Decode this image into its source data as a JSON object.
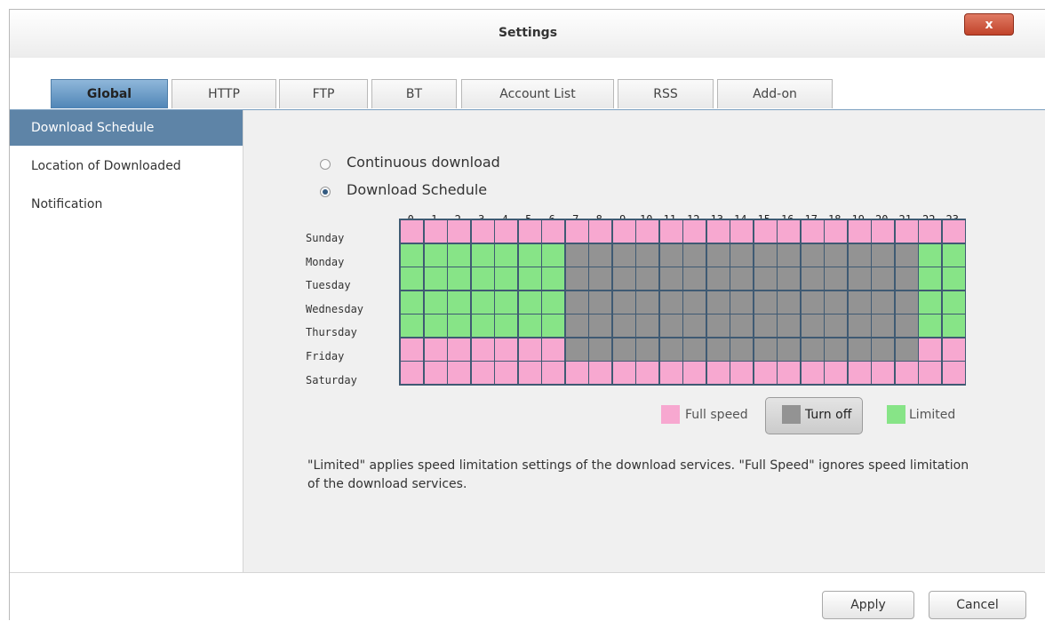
{
  "window": {
    "title": "Settings",
    "close_label": "x"
  },
  "tabs": [
    {
      "label": "Global",
      "active": true
    },
    {
      "label": "HTTP",
      "active": false
    },
    {
      "label": "FTP",
      "active": false
    },
    {
      "label": "BT",
      "active": false
    },
    {
      "label": "Account List",
      "active": false
    },
    {
      "label": "RSS",
      "active": false
    },
    {
      "label": "Add-on",
      "active": false
    }
  ],
  "sidebar": {
    "items": [
      {
        "label": "Download Schedule",
        "active": true
      },
      {
        "label": "Location of Downloaded",
        "active": false
      },
      {
        "label": "Notification",
        "active": false
      }
    ]
  },
  "schedule": {
    "options": [
      {
        "label": "Continuous download",
        "checked": false
      },
      {
        "label": "Download Schedule",
        "checked": true
      }
    ],
    "hours": [
      "0",
      "1",
      "2",
      "3",
      "4",
      "5",
      "6",
      "7",
      "8",
      "9",
      "10",
      "11",
      "12",
      "13",
      "14",
      "15",
      "16",
      "17",
      "18",
      "19",
      "20",
      "21",
      "22",
      "23"
    ],
    "days": [
      "Sunday",
      "Monday",
      "Tuesday",
      "Wednesday",
      "Thursday",
      "Friday",
      "Saturday"
    ],
    "states": {
      "F": {
        "name": "Full speed",
        "color": "#f7a8d0"
      },
      "O": {
        "name": "Turn off",
        "color": "#939393"
      },
      "L": {
        "name": "Limited",
        "color": "#87e487"
      }
    },
    "grid": [
      "FFFFFFFFFFFFFFFFFFFFFFFF",
      "LLLLLLLOOOOOOOOOOOOOOOLL",
      "LLLLLLLOOOOOOOOOOOOOOOLL",
      "LLLLLLLOOOOOOOOOOOOOOOLL",
      "LLLLLLLOOOOOOOOOOOOOOOLL",
      "FFFFFFFOOOOOOOOOOOOOOOFF",
      "FFFFFFFFFFFFFFFFFFFFFFFF"
    ],
    "legend": {
      "full_speed": "Full speed",
      "turn_off": "Turn off",
      "limited": "Limited",
      "selected": "turn_off"
    },
    "note": "\"Limited\" applies speed limitation settings of the download services. \"Full Speed\" ignores speed limitation of the download services."
  },
  "footer": {
    "apply_label": "Apply",
    "cancel_label": "Cancel"
  }
}
